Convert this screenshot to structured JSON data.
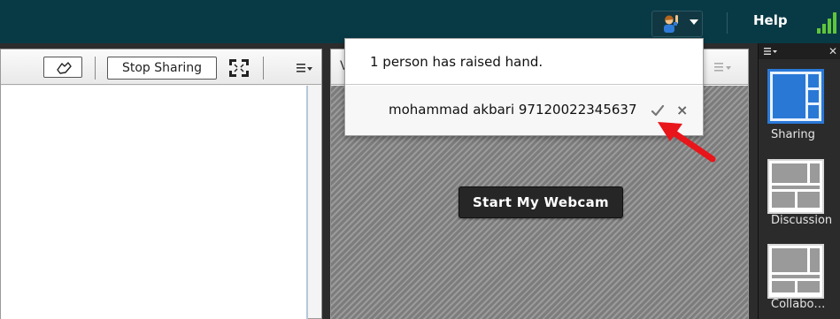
{
  "topbar": {
    "help_label": "Help",
    "attendee_icon": "raise-hand-person-icon"
  },
  "share_pod": {
    "stop_sharing_label": "Stop Sharing",
    "pointer_icon": "pointer-hand-icon",
    "fullscreen_icon": "fullscreen-icon",
    "menu_icon": "pod-menu-icon"
  },
  "video_pod": {
    "title": "V",
    "start_webcam_label": "Start My Webcam"
  },
  "layouts": {
    "items": [
      {
        "label": "Sharing",
        "active": true
      },
      {
        "label": "Discussion",
        "active": false
      },
      {
        "label": "Collabo…",
        "active": false
      }
    ]
  },
  "popup": {
    "message": "1 person has raised hand.",
    "attendee": "mohammad akbari 97120022345637",
    "accept_icon": "check-icon",
    "dismiss_icon": "close-icon",
    "dismiss_glyph": "×"
  },
  "colors": {
    "topbar": "#083a45",
    "accent_arrow": "#e8151b",
    "active_layout": "#2a78d6",
    "signal_green": "#5fc53b"
  }
}
